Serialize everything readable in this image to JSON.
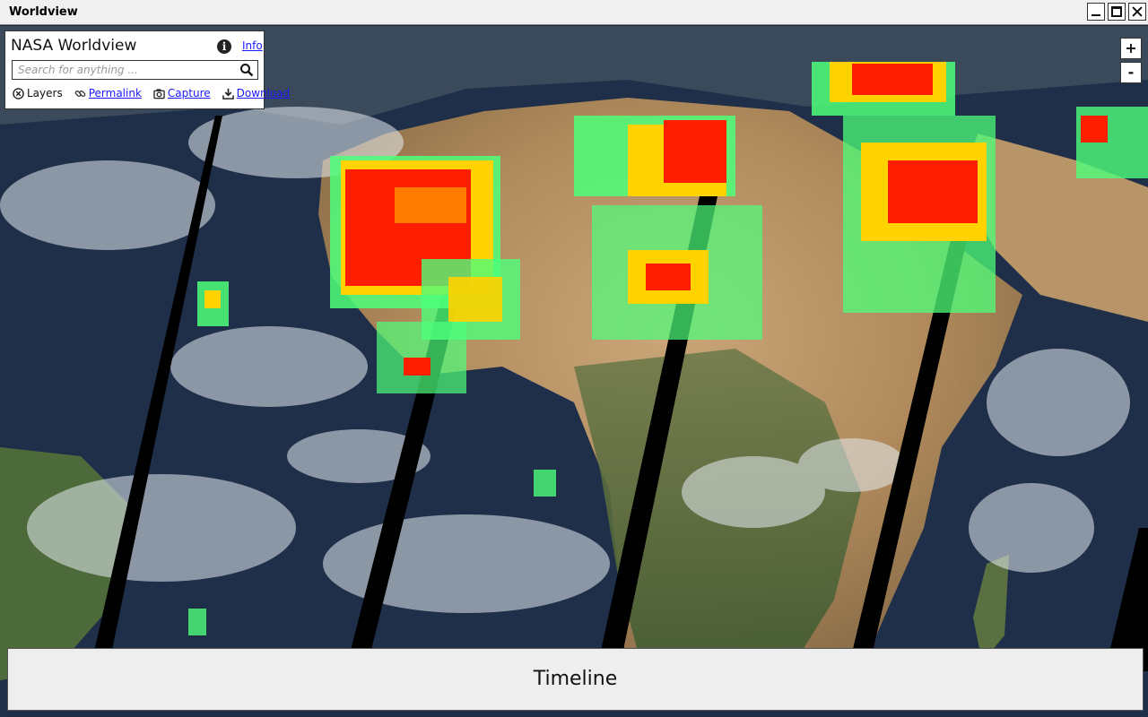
{
  "window": {
    "title": "Worldview"
  },
  "panel": {
    "title": "NASA Worldview",
    "info_label": "Info",
    "search_placeholder": "Search for anything ...",
    "links": {
      "layers": "Layers",
      "permalink": "Permalink",
      "capture": "Capture",
      "download": "Download"
    }
  },
  "zoom": {
    "in_label": "+",
    "out_label": "-"
  },
  "timeline": {
    "label": "Timeline"
  },
  "colors": {
    "link": "#1a1aff",
    "ocean": "#1f2f4a",
    "land": "#b89568",
    "heat_high": "#ff1e00",
    "heat_mid": "#ffd200",
    "heat_low": "#4dff7a",
    "swath_gap": "#000000"
  },
  "icons": {
    "info": "info-icon",
    "search": "search-icon",
    "layers": "close-circle-icon",
    "permalink": "link-icon",
    "capture": "camera-icon",
    "download": "download-icon"
  }
}
